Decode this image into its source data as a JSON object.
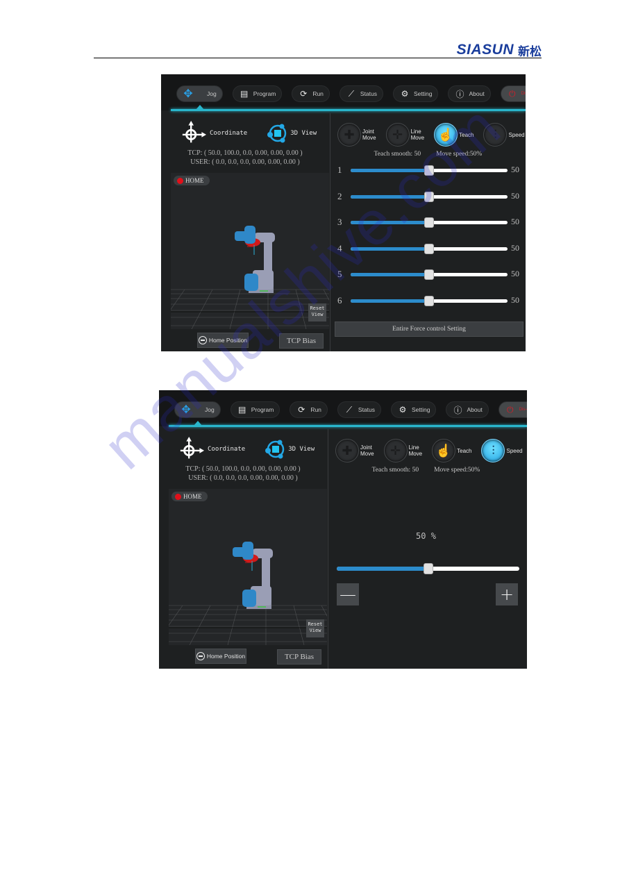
{
  "page_header": {
    "logo_text": "SIASUN",
    "logo_cn": "新松"
  },
  "watermark": "manualshive.com",
  "nav": {
    "items": [
      {
        "label": "Jog",
        "icon": "move-arrows-icon",
        "active": true
      },
      {
        "label": "Program",
        "icon": "program-window-icon"
      },
      {
        "label": "Run",
        "icon": "run-cycle-icon"
      },
      {
        "label": "Status",
        "icon": "line-chart-icon"
      },
      {
        "label": "Setting",
        "icon": "gear-icon"
      },
      {
        "label": "About",
        "icon": "info-icon"
      },
      {
        "label": "Dis-connect",
        "icon": "power-icon"
      }
    ]
  },
  "left_panel": {
    "coordinate_label": "Coordinate",
    "view_label": "3D View",
    "tcp_pose": "TCP: ( 50.0, 100.0, 0.0, 0.00, 0.00, 0.00 )",
    "user_pose": "USER: ( 0.0, 0.0, 0.0, 0.00, 0.00, 0.00 )",
    "home_badge": "HOME",
    "reset_view_line1": "Reset",
    "reset_view_line2": "View",
    "home_position_label": "Home Position",
    "tcp_bias_label": "TCP Bias"
  },
  "modes": [
    {
      "line1": "Joint",
      "line2": "Move",
      "icon": "joint-move-icon"
    },
    {
      "line1": "Line",
      "line2": "Move",
      "icon": "line-move-icon"
    },
    {
      "line1": "Teach",
      "line2": "",
      "icon": "teach-hand-icon"
    },
    {
      "line1": "Speed",
      "line2": "",
      "icon": "speed-sliders-icon"
    }
  ],
  "status": {
    "teach_smooth": "Teach smooth: 50",
    "move_speed": "Move speed:50%"
  },
  "screen1": {
    "active_mode": "Teach",
    "joints": [
      {
        "label": "1",
        "value": 50,
        "value_text": "50",
        "max": 100
      },
      {
        "label": "2",
        "value": 50,
        "value_text": "50",
        "max": 100
      },
      {
        "label": "3",
        "value": 50,
        "value_text": "50",
        "max": 100
      },
      {
        "label": "4",
        "value": 50,
        "value_text": "50",
        "max": 100
      },
      {
        "label": "5",
        "value": 50,
        "value_text": "50",
        "max": 100
      },
      {
        "label": "6",
        "value": 50,
        "value_text": "50",
        "max": 100
      }
    ],
    "force_button": "Entire Force control Setting"
  },
  "screen2": {
    "active_mode": "Speed",
    "speed_value": 50,
    "speed_text": "50  %",
    "minus_label": "—",
    "plus_label": "+"
  },
  "colors": {
    "accent": "#29b6cc",
    "slider_fill": "#2c8ccc",
    "mode_active": "#1d9fe0",
    "disconnect": "#d0202a",
    "home_dot": "#e0101a",
    "logo": "#1b3e9c"
  }
}
